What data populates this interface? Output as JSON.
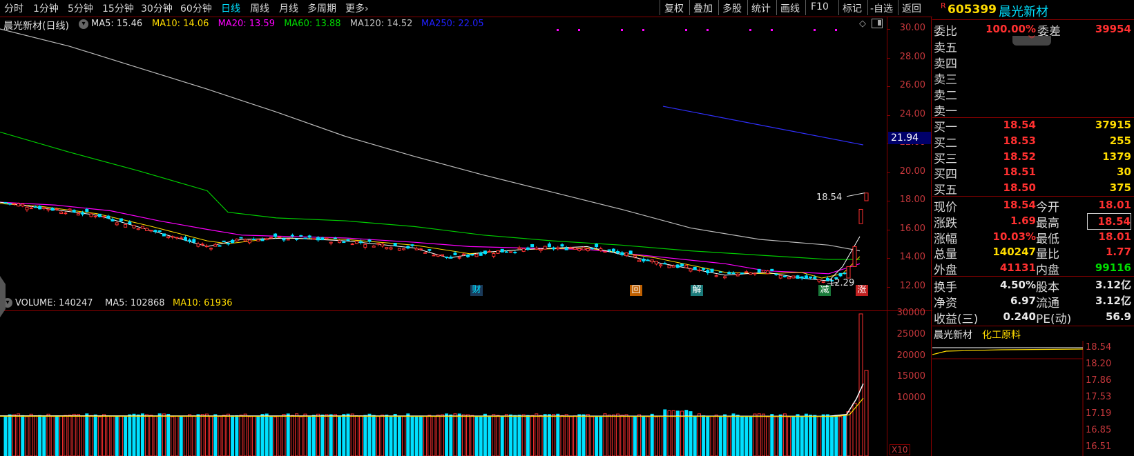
{
  "toolbar": {
    "periods": [
      "分时",
      "1分钟",
      "5分钟",
      "15分钟",
      "30分钟",
      "60分钟",
      "日线",
      "周线",
      "月线",
      "多周期",
      "更多"
    ],
    "active_period": "日线",
    "more_arrow": "›",
    "actions": [
      "复权",
      "叠加",
      "多股",
      "统计",
      "画线",
      "F10",
      "标记",
      "-自选",
      "返回"
    ]
  },
  "price_chart": {
    "title": "晨光新材(日线)",
    "ma": [
      {
        "label": "MA5: 15.46",
        "color": "#e0e0e0"
      },
      {
        "label": "MA10: 14.06",
        "color": "#ffdc00"
      },
      {
        "label": "MA20: 13.59",
        "color": "#ff00ff"
      },
      {
        "label": "MA60: 13.88",
        "color": "#00dd00"
      },
      {
        "label": "MA120: 14.52",
        "color": "#c0c0c0"
      },
      {
        "label": "MA250: 22.05",
        "color": "#2020ff"
      }
    ],
    "y_ticks": [
      "30.00",
      "28.00",
      "26.00",
      "24.00",
      "22.00",
      "20.00",
      "18.00",
      "16.00",
      "14.00",
      "12.00"
    ],
    "current_price_tag": "21.94",
    "high_annotation": "18.54",
    "low_annotation": "12.29",
    "event_badges": [
      {
        "text": "财",
        "color": "#00e0ff",
        "bg": "#1a3a5a"
      },
      {
        "text": "回",
        "color": "#ffffff",
        "bg": "#c06000"
      },
      {
        "text": "解",
        "color": "#ffffff",
        "bg": "#1a7a7a"
      },
      {
        "text": "减",
        "color": "#ffffff",
        "bg": "#1a7a3a"
      },
      {
        "text": "涨",
        "color": "#ffffff",
        "bg": "#c02020"
      }
    ]
  },
  "volume_chart": {
    "title": "VOLUME: 140247",
    "ma5": "MA5: 102868",
    "ma10": "MA10: 61936",
    "y_ticks": [
      "30000",
      "25000",
      "20000",
      "15000",
      "10000"
    ],
    "unit": "X10"
  },
  "quote": {
    "flag": "R",
    "code": "605399",
    "name": "晨光新材",
    "wei_bi_label": "委比",
    "wei_bi": "100.00%",
    "wei_cha_label": "委差",
    "wei_cha": "39954",
    "sells": [
      {
        "label": "卖五",
        "price": "",
        "vol": ""
      },
      {
        "label": "卖四",
        "price": "",
        "vol": ""
      },
      {
        "label": "卖三",
        "price": "",
        "vol": ""
      },
      {
        "label": "卖二",
        "price": "",
        "vol": ""
      },
      {
        "label": "卖一",
        "price": "",
        "vol": ""
      }
    ],
    "buys": [
      {
        "label": "买一",
        "price": "18.54",
        "vol": "37915"
      },
      {
        "label": "买二",
        "price": "18.53",
        "vol": "255"
      },
      {
        "label": "买三",
        "price": "18.52",
        "vol": "1379"
      },
      {
        "label": "买四",
        "price": "18.51",
        "vol": "30"
      },
      {
        "label": "买五",
        "price": "18.50",
        "vol": "375"
      }
    ],
    "stats1": [
      {
        "l1": "现价",
        "v1": "18.54",
        "c1": "red",
        "l2": "今开",
        "v2": "18.01",
        "c2": "red"
      },
      {
        "l1": "涨跌",
        "v1": "1.69",
        "c1": "red",
        "l2": "最高",
        "v2": "18.54",
        "c2": "red"
      },
      {
        "l1": "涨幅",
        "v1": "10.03%",
        "c1": "red",
        "l2": "最低",
        "v2": "18.01",
        "c2": "red"
      },
      {
        "l1": "总量",
        "v1": "140247",
        "c1": "yellow",
        "l2": "量比",
        "v2": "1.77",
        "c2": "red"
      },
      {
        "l1": "外盘",
        "v1": "41131",
        "c1": "red",
        "l2": "内盘",
        "v2": "99116",
        "c2": "green"
      }
    ],
    "stats2": [
      {
        "l1": "换手",
        "v1": "4.50%",
        "l2": "股本",
        "v2": "3.12亿"
      },
      {
        "l1": "净资",
        "v1": "6.97",
        "l2": "流通",
        "v2": "3.12亿"
      },
      {
        "l1": "收益(三)",
        "v1": "0.240",
        "l2": "PE(动)",
        "v2": "56.9"
      }
    ],
    "mini_name": "晨光新材",
    "mini_sector": "化工原料",
    "mini_ticks": [
      "18.54",
      "18.20",
      "17.86",
      "17.53",
      "17.19",
      "16.85",
      "16.51"
    ]
  }
}
